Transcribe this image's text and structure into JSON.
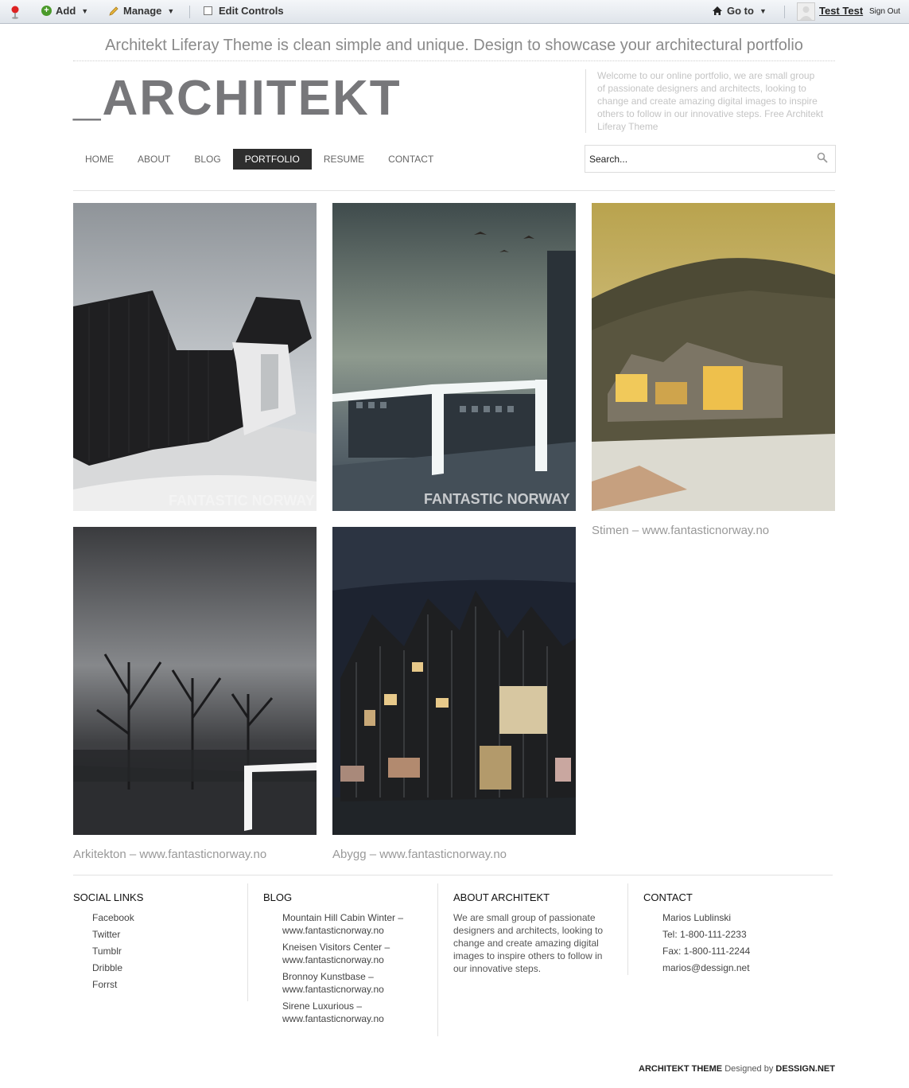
{
  "dockbar": {
    "add": "Add",
    "manage": "Manage",
    "edit_controls": "Edit Controls",
    "goto": "Go to",
    "user": "Test Test",
    "signout": "Sign Out"
  },
  "header": {
    "tagline": "Architekt Liferay Theme is clean simple and unique. Design to showcase your architectural portfolio",
    "logo": "_ARCHITEKT",
    "welcome": "Welcome to our online portfolio, we are small group of passionate designers and architects, looking to change and create amazing digital images to inspire others to follow in our innovative steps. Free Architekt Liferay Theme"
  },
  "nav": {
    "items": [
      "HOME",
      "ABOUT",
      "BLOG",
      "PORTFOLIO",
      "RESUME",
      "CONTACT"
    ],
    "active": "PORTFOLIO"
  },
  "search": {
    "placeholder": "Search..."
  },
  "portfolio": {
    "watermark": "FANTASTIC NORWAY",
    "captions": [
      "Stimen – www.fantasticnorway.no",
      "Arkitekton – www.fantasticnorway.no",
      "Abygg – www.fantasticnorway.no"
    ]
  },
  "footer": {
    "social": {
      "title": "SOCIAL LINKS",
      "items": [
        "Facebook",
        "Twitter",
        "Tumblr",
        "Dribble",
        "Forrst"
      ]
    },
    "blog": {
      "title": "BLOG",
      "items": [
        "Mountain Hill Cabin Winter – www.fantasticnorway.no",
        "Kneisen Visitors Center – www.fantasticnorway.no",
        "Bronnoy Kunstbase – www.fantasticnorway.no",
        "Sirene Luxurious – www.fantasticnorway.no"
      ]
    },
    "about": {
      "title": "ABOUT ARCHITEKT",
      "text": "We are small group of passionate designers and architects, looking to change and create amazing digital images to inspire others to follow in our innovative steps."
    },
    "contact": {
      "title": "CONTACT",
      "items": [
        "Marios Lublinski",
        "Tel: 1-800-111-2233",
        "Fax: 1-800-111-2244",
        "marios@dessign.net"
      ]
    }
  },
  "credit": {
    "theme": "ARCHITEKT THEME",
    "designed_by": "Designed by",
    "brand": "DESSIGN.NET"
  }
}
